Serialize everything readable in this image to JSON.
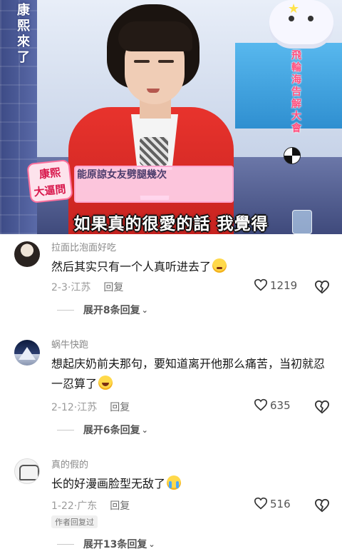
{
  "video": {
    "show_title_vertical": "康熙來了",
    "side_title": "飛輪海告解大會",
    "tag_line1": "康熙",
    "tag_line2": "大逼問",
    "topic_text": "能原諒女友劈腿幾次",
    "subtitle": "如果真的很愛的話 我覺得"
  },
  "comments": [
    {
      "username": "拉面比泡面好吃",
      "text": "然后其实只有一个人真听进去了",
      "emoji": "wink-face-icon",
      "date": "2-3",
      "location": "江苏",
      "reply_label": "回复",
      "likes": "1219",
      "expand_label": "展开8条回复"
    },
    {
      "username": "蜗牛快跑",
      "text": "想起庆奶前夫那句，要知道离开他那么痛苦，当初就忍一忍算了",
      "emoji": "laughing-crying-face-icon",
      "date": "2-12",
      "location": "江苏",
      "reply_label": "回复",
      "likes": "635",
      "expand_label": "展开6条回复"
    },
    {
      "username": "真的假的",
      "text": "长的好漫画脸型无敌了",
      "emoji": "crying-face-icon",
      "date": "1-22",
      "location": "广东",
      "reply_label": "回复",
      "likes": "516",
      "author_tag": "作者回复过",
      "expand_label": "展开13条回复"
    }
  ],
  "separator": "·",
  "chevron": "⌄"
}
